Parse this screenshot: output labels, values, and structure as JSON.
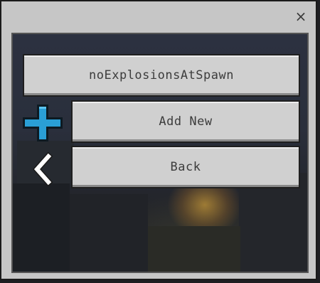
{
  "dialog": {
    "close_label": "×"
  },
  "entries": [
    {
      "label": "noExplosionsAtSpawn"
    }
  ],
  "actions": {
    "add_new_label": "Add New",
    "back_label": "Back"
  },
  "icons": {
    "add": "plus-icon",
    "back": "chevron-left-icon",
    "close": "close-icon"
  },
  "colors": {
    "button_face": "#d0d0d0",
    "button_text": "#3c3c3c",
    "accent_blue": "#2a9fd6",
    "dialog_bg": "#c6c6c6"
  }
}
